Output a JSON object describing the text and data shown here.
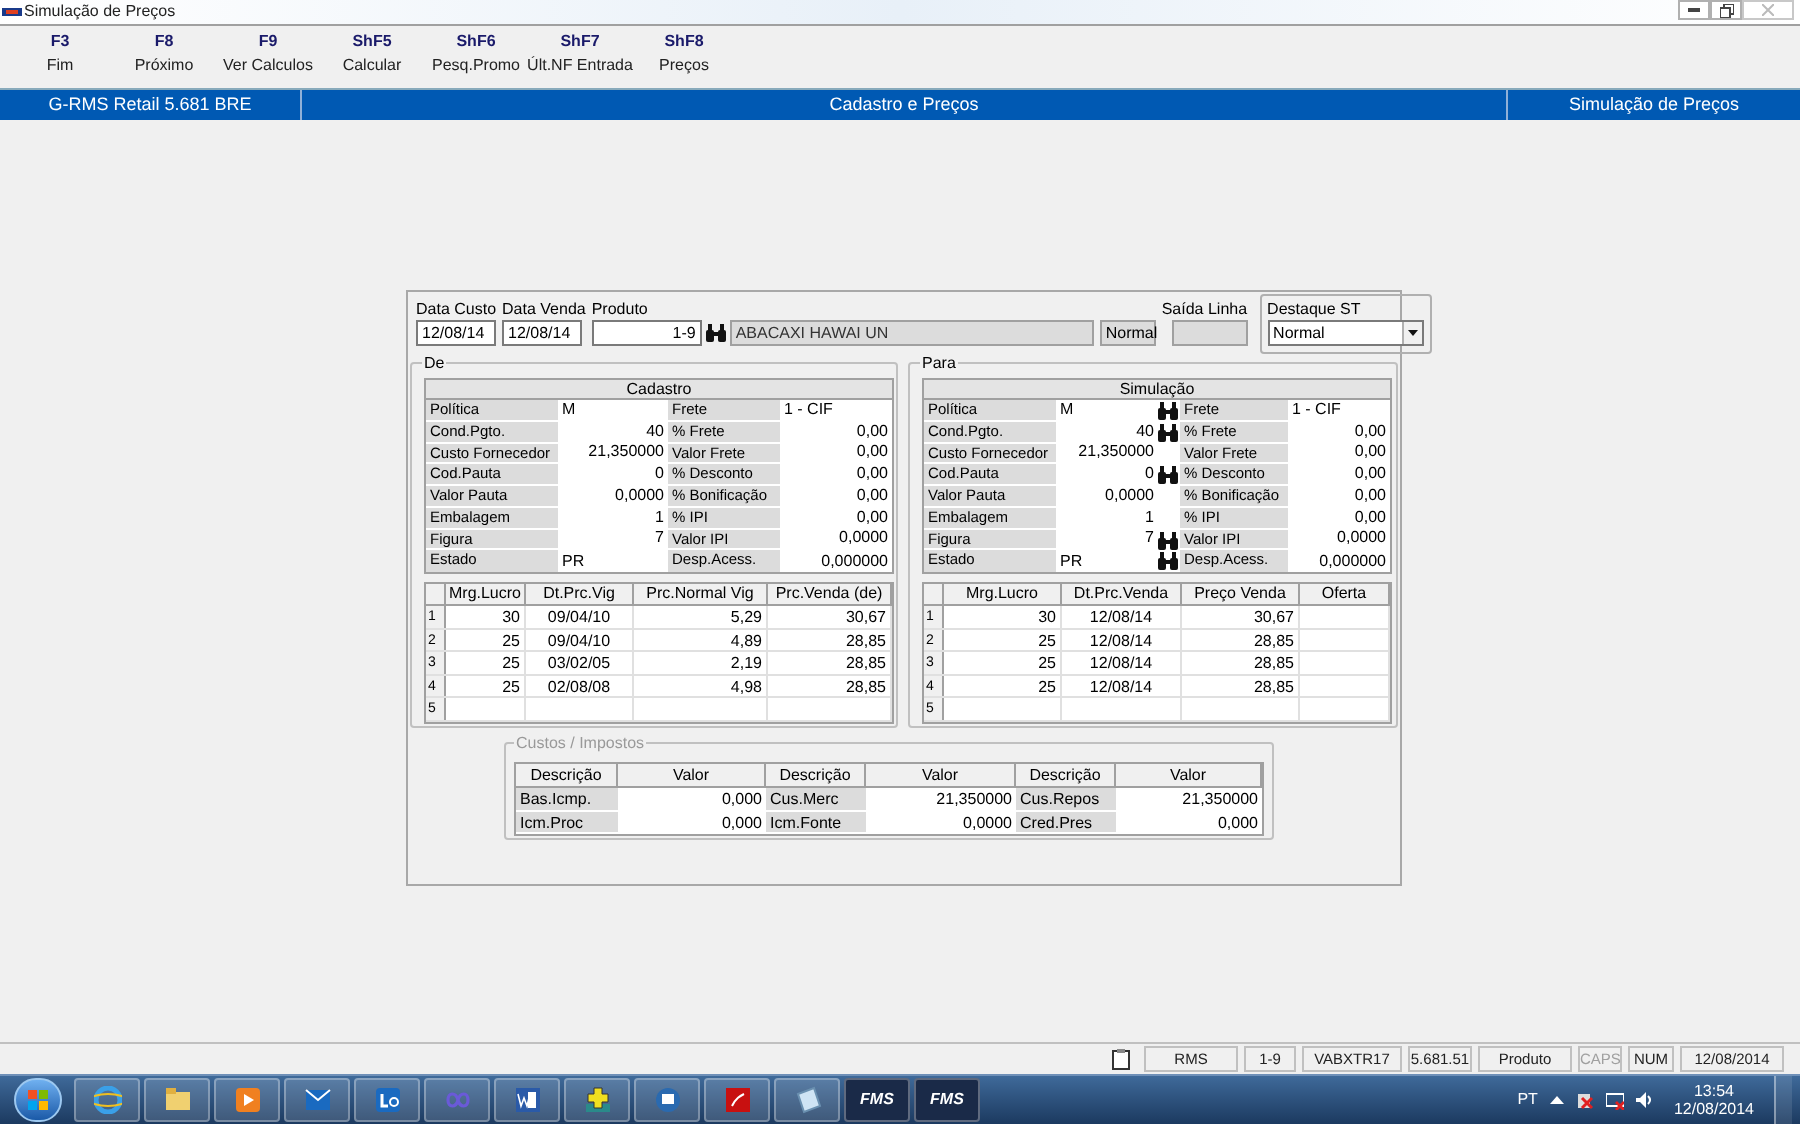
{
  "window": {
    "title": "Simulação de Preços"
  },
  "function_keys": [
    {
      "key": "F3",
      "label": "Fim"
    },
    {
      "key": "F8",
      "label": "Próximo"
    },
    {
      "key": "F9",
      "label": "Ver Calculos"
    },
    {
      "key": "ShF5",
      "label": "Calcular"
    },
    {
      "key": "ShF6",
      "label": "Pesq.Promo"
    },
    {
      "key": "ShF7",
      "label": "Últ.NF Entrada"
    },
    {
      "key": "ShF8",
      "label": "Preços"
    }
  ],
  "header_bar": [
    "G-RMS Retail 5.681 BRE",
    "Cadastro e Preços",
    "Simulação de Preços"
  ],
  "form": {
    "data_custo": {
      "label": "Data Custo",
      "value": "12/08/14"
    },
    "data_venda": {
      "label": "Data Venda",
      "value": "12/08/14"
    },
    "produto": {
      "label": "Produto",
      "code": "1-9",
      "name": "ABACAXI HAWAI UN",
      "type": "Normal"
    },
    "saida_linha": {
      "label": "Saída Linha"
    },
    "destaque_st": {
      "label": "Destaque ST",
      "value": "Normal"
    }
  },
  "de": {
    "title": "De",
    "table_title": "Cadastro",
    "rows": [
      {
        "kind": "text",
        "label": "Política",
        "value": "M",
        "label2": "Frete",
        "value2": "1 - CIF"
      },
      {
        "kind": "number",
        "label": "Cond.Pgto.",
        "value": "40",
        "label2": "% Frete",
        "value2": "0,00"
      },
      {
        "kind": "number",
        "label": "Custo Fornecedor",
        "value": "21,350000",
        "label2": "Valor Frete",
        "value2": "0,00"
      },
      {
        "kind": "number",
        "label": "Cod.Pauta",
        "value": "0",
        "label2": "% Desconto",
        "value2": "0,00"
      },
      {
        "kind": "number",
        "label": "Valor Pauta",
        "value": "0,0000",
        "label2": "% Bonificação",
        "value2": "0,00"
      },
      {
        "kind": "number",
        "label": "Embalagem",
        "value": "1",
        "label2": "% IPI",
        "value2": "0,00"
      },
      {
        "kind": "number",
        "label": "Figura",
        "value": "7",
        "label2": "Valor IPI",
        "value2": "0,0000"
      },
      {
        "kind": "mixed",
        "label": "Estado",
        "value": "PR",
        "label2": "Desp.Acess.",
        "value2": "0,000000"
      }
    ],
    "history": {
      "columns": [
        "",
        "Mrg.Lucro",
        "Dt.Prc.Vig",
        "Prc.Normal Vig",
        "Prc.Venda (de)"
      ],
      "rows": [
        [
          "1",
          "30",
          "09/04/10",
          "5,29",
          "30,67"
        ],
        [
          "2",
          "25",
          "09/04/10",
          "4,89",
          "28,85"
        ],
        [
          "3",
          "25",
          "03/02/05",
          "2,19",
          "28,85"
        ],
        [
          "4",
          "25",
          "02/08/08",
          "4,98",
          "28,85"
        ],
        [
          "5"
        ]
      ]
    }
  },
  "para": {
    "title": "Para",
    "table_title": "Simulação",
    "rows": [
      {
        "kind": "text",
        "label": "Política",
        "value": "M",
        "lookup": true,
        "label2": "Frete",
        "value2": "1 - CIF"
      },
      {
        "kind": "number",
        "label": "Cond.Pgto.",
        "value": "40",
        "lookup": true,
        "label2": "% Frete",
        "value2": "0,00"
      },
      {
        "kind": "number",
        "label": "Custo Fornecedor",
        "value": "21,350000",
        "lookup": false,
        "label2": "Valor Frete",
        "value2": "0,00"
      },
      {
        "kind": "number",
        "label": "Cod.Pauta",
        "value": "0",
        "lookup": true,
        "label2": "% Desconto",
        "value2": "0,00"
      },
      {
        "kind": "number",
        "label": "Valor Pauta",
        "value": "0,0000",
        "lookup": false,
        "label2": "% Bonificação",
        "value2": "0,00"
      },
      {
        "kind": "number",
        "label": "Embalagem",
        "value": "1",
        "lookup": false,
        "label2": "% IPI",
        "value2": "0,00"
      },
      {
        "kind": "number",
        "label": "Figura",
        "value": "7",
        "lookup": true,
        "label2": "Valor IPI",
        "value2": "0,0000"
      },
      {
        "kind": "mixed",
        "label": "Estado",
        "value": "PR",
        "lookup": true,
        "label2": "Desp.Acess.",
        "value2": "0,000000"
      }
    ],
    "history": {
      "columns": [
        "",
        "Mrg.Lucro",
        "Dt.Prc.Venda",
        "Preço Venda",
        "Oferta"
      ],
      "rows": [
        [
          "1",
          "30",
          "12/08/14",
          "30,67"
        ],
        [
          "2",
          "25",
          "12/08/14",
          "28,85"
        ],
        [
          "3",
          "25",
          "12/08/14",
          "28,85"
        ],
        [
          "4",
          "25",
          "12/08/14",
          "28,85"
        ],
        [
          "5"
        ]
      ]
    }
  },
  "custos": {
    "title": "Custos / Impostos",
    "columns": [
      "Descrição",
      "Valor",
      "Descrição",
      "Valor",
      "Descrição",
      "Valor"
    ],
    "rows": [
      [
        "Bas.Icmp.",
        "0,000",
        "Cus.Merc",
        "21,350000",
        "Cus.Repos",
        "21,350000"
      ],
      [
        "Icm.Proc",
        "0,000",
        "Icm.Fonte",
        "0,0000",
        "Cred.Pres",
        "0,000"
      ]
    ]
  },
  "status_bar": [
    {
      "text": "RMS",
      "disabled": false
    },
    {
      "text": "1-9",
      "disabled": false
    },
    {
      "text": "VABXTR17",
      "disabled": false
    },
    {
      "text": "5.681.51",
      "disabled": false
    },
    {
      "text": "Produto",
      "disabled": false
    },
    {
      "text": "CAPS",
      "disabled": true
    },
    {
      "text": "NUM",
      "disabled": false
    },
    {
      "text": "12/08/2014",
      "disabled": false
    }
  ],
  "taskbar": {
    "apps": [
      {
        "kind": "browser"
      },
      {
        "kind": "folder"
      },
      {
        "kind": "media"
      },
      {
        "kind": "mail"
      },
      {
        "kind": "chat"
      },
      {
        "kind": "loop"
      },
      {
        "kind": "document"
      },
      {
        "kind": "plus"
      },
      {
        "kind": "network"
      },
      {
        "kind": "pdf"
      },
      {
        "kind": "notes"
      },
      {
        "kind": "fms",
        "label": "FMS"
      },
      {
        "kind": "fms",
        "label": "FMS"
      }
    ],
    "language": "PT",
    "time": "13:54",
    "date": "12/08/2014"
  }
}
